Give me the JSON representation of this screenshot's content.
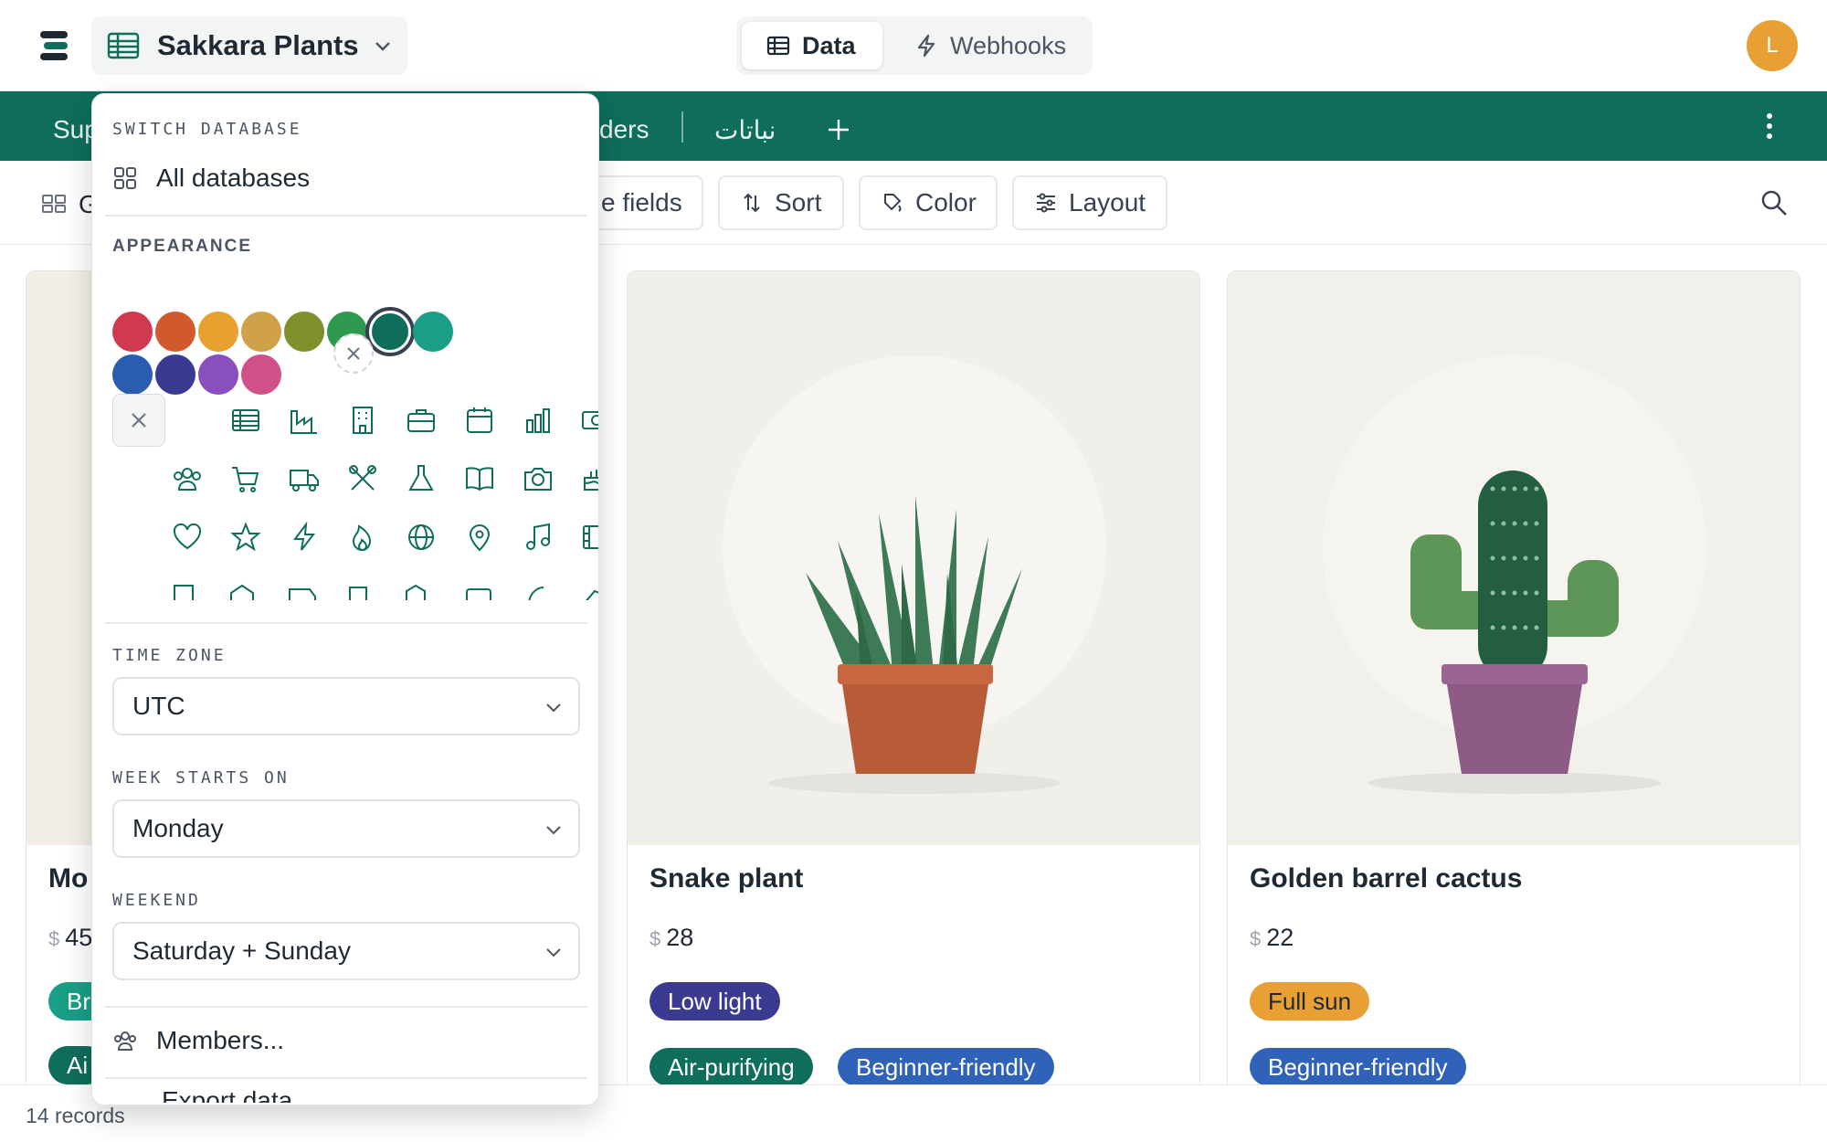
{
  "topbar": {
    "database_name": "Sakkara Plants",
    "view_toggle": {
      "data_label": "Data",
      "webhooks_label": "Webhooks"
    },
    "avatar_initial": "L",
    "avatar_color": "#e8a035"
  },
  "tabs": {
    "items": [
      "Sup",
      "ders",
      "نباتات"
    ],
    "accent": "#0f6d5c"
  },
  "toolbar": {
    "gallery_label": "G",
    "fields_label": "e fields",
    "sort_label": "Sort",
    "color_label": "Color",
    "layout_label": "Layout"
  },
  "cards": [
    {
      "title": "Mo",
      "price": "45",
      "chips": [
        {
          "label": "Br",
          "color": "#1a9e86"
        },
        {
          "label": "Ai",
          "color": "#0f6d5c"
        }
      ]
    },
    {
      "title": "Snake plant",
      "price": "28",
      "chips": [
        {
          "label": "Low light",
          "color": "#3b3a91"
        },
        {
          "label": "Air-purifying",
          "color": "#0f6d5c"
        },
        {
          "label": "Beginner-friendly",
          "color": "#2f62b8"
        }
      ]
    },
    {
      "title": "Golden barrel cactus",
      "price": "22",
      "chips": [
        {
          "label": "Full sun",
          "color": "#e8a035"
        },
        {
          "label": "Beginner-friendly",
          "color": "#2f62b8"
        }
      ]
    }
  ],
  "currency_symbol": "$",
  "footer": {
    "records": "14 records"
  },
  "dropdown": {
    "switch_label": "SWITCH DATABASE",
    "all_databases": "All databases",
    "appearance_label": "APPEARANCE",
    "colors": [
      "#d03a4f",
      "#d05a2e",
      "#e8a030",
      "#cfa24a",
      "#7f8f2a",
      "#2f9a4f",
      "#0f6d5c",
      "#1a9e86",
      "#2a5db0",
      "#3b3a91",
      "#8a4fbf",
      "#d0508a"
    ],
    "selected_color": "#0f6d5c",
    "icons_row1": [
      "no-icon",
      "table-icon",
      "factory-icon",
      "building-icon",
      "briefcase-icon",
      "calendar-icon",
      "bar-chart-icon",
      "money-icon"
    ],
    "icons_row2": [
      "team-icon",
      "cart-icon",
      "truck-icon",
      "tools-icon",
      "flask-icon",
      "book-icon",
      "camera-icon",
      "cake-icon"
    ],
    "icons_row3": [
      "heart-icon",
      "star-icon",
      "bolt-icon",
      "flame-icon",
      "globe-icon",
      "pin-icon",
      "music-icon",
      "film-icon"
    ],
    "time_zone_label": "TIME ZONE",
    "time_zone_value": "UTC",
    "week_starts_label": "WEEK STARTS ON",
    "week_starts_value": "Monday",
    "weekend_label": "WEEKEND",
    "weekend_value": "Saturday + Sunday",
    "members_label": "Members...",
    "partial_item_label": "Export data..."
  }
}
